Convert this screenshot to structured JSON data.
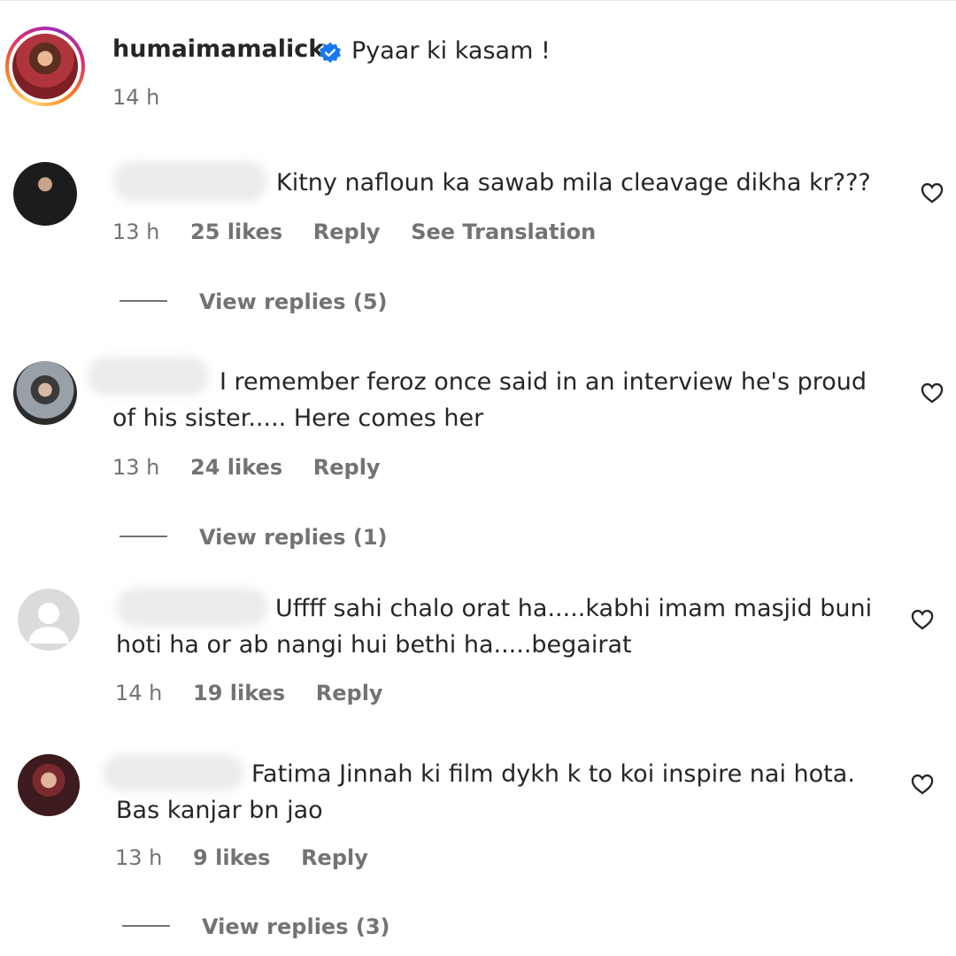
{
  "colors": {
    "text": "#262626",
    "secondary": "#737373",
    "verified": "#1877f2",
    "ring": [
      "#feda75",
      "#fa7e1e",
      "#d62976",
      "#962fbf"
    ]
  },
  "caption": {
    "username": "humaimamalick",
    "verified_icon": "verified-badge-icon",
    "text": "Pyaar ki kasam !",
    "time": "14 h"
  },
  "comments": [
    {
      "text": "Kitny nafloun ka sawab mila cleavage dikha kr???",
      "time": "13 h",
      "likes": "25 likes",
      "reply": "Reply",
      "translate": "See Translation",
      "view_replies": "View replies (5)",
      "like_icon": "heart-icon"
    },
    {
      "text_prefix": "I",
      "text": "I remember feroz once said in an interview he's proud of his sister..... Here comes her",
      "line1": "I remember feroz once said in an interview he's proud",
      "line2": "of his sister..... Here comes her",
      "time": "13 h",
      "likes": "24 likes",
      "reply": "Reply",
      "view_replies": "View replies (1)",
      "like_icon": "heart-icon"
    },
    {
      "text": "Uffff sahi chalo orat ha.....kabhi imam masjid buni hoti ha or ab nangi hui bethi ha.....begairat",
      "line1": "Uffff sahi chalo orat ha.....kabhi imam masjid buni",
      "line2": "hoti ha or ab nangi hui bethi ha.....begairat",
      "time": "14 h",
      "likes": "19 likes",
      "reply": "Reply",
      "like_icon": "heart-icon"
    },
    {
      "text": "Fatima Jinnah ki film dykh k to koi inspire nai hota. Bas kanjar bn jao",
      "line1": "Fatima Jinnah ki film dykh k to koi inspire nai hota.",
      "line2": "Bas kanjar bn jao",
      "time": "13 h",
      "likes": "9 likes",
      "reply": "Reply",
      "view_replies": "View replies (3)",
      "like_icon": "heart-icon"
    }
  ]
}
